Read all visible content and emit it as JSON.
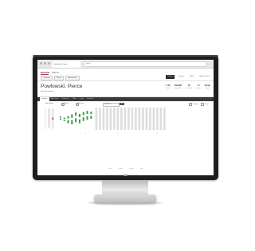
{
  "browser": {
    "tab_title": "Powlowski, Pierce",
    "url": "https://"
  },
  "app": {
    "logo": "BlueStar",
    "product": "DiaPort",
    "header_buttons": [
      "Dashboard",
      "Patients",
      "Administration"
    ],
    "nav": [
      {
        "label": "Patients",
        "active": true
      },
      {
        "label": "Reports",
        "active": false
      },
      {
        "label": "Alerts",
        "active": false
      },
      {
        "label": "Administration",
        "active": false
      }
    ]
  },
  "patient": {
    "name": "Powlowski, Pierce",
    "sub_link": "Edit Demographics",
    "stats": [
      {
        "value": "0.50",
        "label": "Basal",
        "alert": false
      },
      {
        "value": "130/180",
        "label": "Target BG",
        "alert": false
      },
      {
        "value": "16",
        "label": "Carb Ratio",
        "alert": false
      },
      {
        "value": "45",
        "label": "Insulin",
        "alert": true
      },
      {
        "value": "Pump",
        "label": "Device",
        "alert": false
      }
    ]
  },
  "tabs": [
    {
      "label": "Glucose",
      "active": true
    },
    {
      "label": "Meter Data",
      "active": false
    },
    {
      "label": "Treatment",
      "active": false
    },
    {
      "label": "Plans",
      "active": false
    },
    {
      "label": "Logs",
      "active": false
    },
    {
      "label": "Providers",
      "active": false
    }
  ],
  "toolbar": {
    "filter_label": "Date Range",
    "options": [
      "7 Days",
      "14 Days"
    ],
    "date_value": "08/02/2015",
    "go_label": "Go",
    "legend": [
      "Average",
      "Range"
    ]
  },
  "chart_data": {
    "type": "box",
    "title": "",
    "ylabel": "",
    "highlight_color": "#c0302b",
    "series_color": "#3c9a3c",
    "placeholder_color": "#dddddd",
    "highlighted_index": 1,
    "boxes": [
      {
        "low": 0.1,
        "high": 0.95,
        "mark": null
      },
      {
        "low": 0.05,
        "high": 0.95,
        "mark": 0.55
      },
      {
        "low": null,
        "high": null,
        "mark": null
      },
      {
        "low": 0.45,
        "high": 0.6,
        "mark": null
      },
      {
        "low": 0.4,
        "high": 0.55,
        "mark": null
      },
      {
        "low": 0.3,
        "high": 0.62,
        "mark": null
      },
      {
        "low": 0.25,
        "high": 0.7,
        "mark": null
      },
      {
        "low": 0.35,
        "high": 0.78,
        "mark": null
      },
      {
        "low": 0.3,
        "high": 0.72,
        "mark": null
      },
      {
        "low": 0.4,
        "high": 0.8,
        "mark": null
      },
      {
        "low": 0.45,
        "high": 0.85,
        "mark": null
      },
      {
        "low": 0.5,
        "high": 0.82,
        "mark": null
      }
    ],
    "empty_slots": 20,
    "week_labels": [
      "1",
      "2",
      "3"
    ]
  },
  "footer": {
    "links": [
      "Terms",
      "Privacy",
      "Contact",
      "Help"
    ]
  }
}
